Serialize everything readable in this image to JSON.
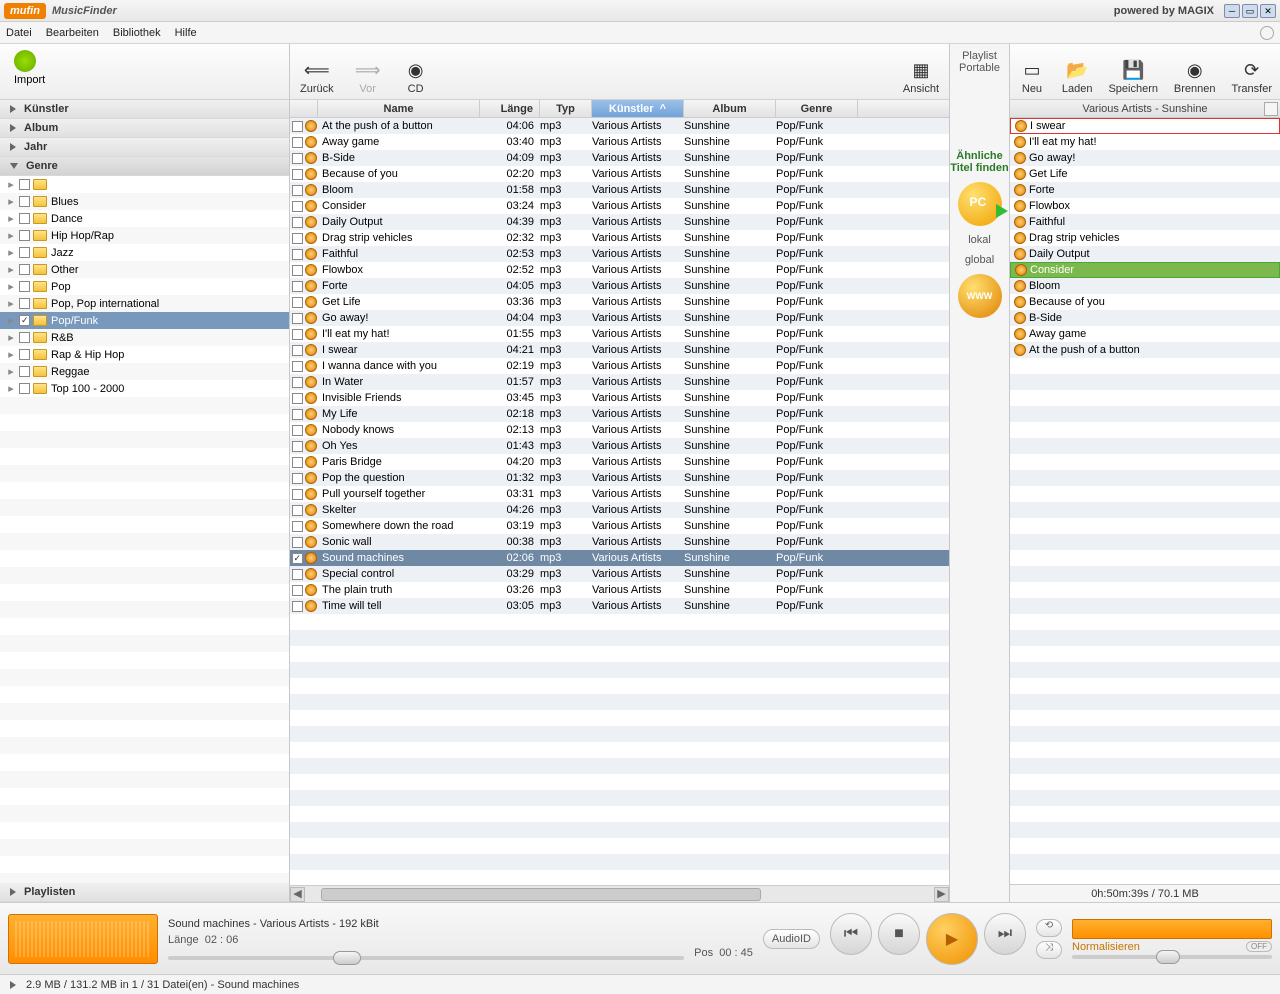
{
  "title": {
    "logo": "mufin",
    "app": "MusicFinder",
    "powered": "powered by MAGIX"
  },
  "menu": [
    "Datei",
    "Bearbeiten",
    "Bibliothek",
    "Hilfe"
  ],
  "left": {
    "import": "Import",
    "sections": [
      "Künstler",
      "Album",
      "Jahr",
      "Genre",
      "Playlisten"
    ],
    "genres": [
      {
        "label": ""
      },
      {
        "label": "Blues"
      },
      {
        "label": "Dance"
      },
      {
        "label": "Hip Hop/Rap"
      },
      {
        "label": "Jazz"
      },
      {
        "label": "Other"
      },
      {
        "label": "Pop"
      },
      {
        "label": "Pop, Pop international"
      },
      {
        "label": "Pop/Funk",
        "sel": true,
        "chk": true
      },
      {
        "label": "R&B"
      },
      {
        "label": "Rap & Hip Hop"
      },
      {
        "label": "Reggae"
      },
      {
        "label": "Top 100 - 2000"
      }
    ]
  },
  "centerToolbar": {
    "back": "Zurück",
    "fwd": "Vor",
    "cd": "CD",
    "view": "Ansicht"
  },
  "cols": [
    "Name",
    "Länge",
    "Typ",
    "Künstler",
    "Album",
    "Genre"
  ],
  "sortIndicator": "^",
  "tracks": [
    {
      "n": "At the push of a button",
      "l": "04:06",
      "t": "mp3",
      "a": "Various Artists",
      "al": "Sunshine",
      "g": "Pop/Funk"
    },
    {
      "n": "Away game",
      "l": "03:40",
      "t": "mp3",
      "a": "Various Artists",
      "al": "Sunshine",
      "g": "Pop/Funk"
    },
    {
      "n": "B-Side",
      "l": "04:09",
      "t": "mp3",
      "a": "Various Artists",
      "al": "Sunshine",
      "g": "Pop/Funk"
    },
    {
      "n": "Because of you",
      "l": "02:20",
      "t": "mp3",
      "a": "Various Artists",
      "al": "Sunshine",
      "g": "Pop/Funk"
    },
    {
      "n": "Bloom",
      "l": "01:58",
      "t": "mp3",
      "a": "Various Artists",
      "al": "Sunshine",
      "g": "Pop/Funk"
    },
    {
      "n": "Consider",
      "l": "03:24",
      "t": "mp3",
      "a": "Various Artists",
      "al": "Sunshine",
      "g": "Pop/Funk"
    },
    {
      "n": "Daily Output",
      "l": "04:39",
      "t": "mp3",
      "a": "Various Artists",
      "al": "Sunshine",
      "g": "Pop/Funk"
    },
    {
      "n": "Drag strip vehicles",
      "l": "02:32",
      "t": "mp3",
      "a": "Various Artists",
      "al": "Sunshine",
      "g": "Pop/Funk"
    },
    {
      "n": "Faithful",
      "l": "02:53",
      "t": "mp3",
      "a": "Various Artists",
      "al": "Sunshine",
      "g": "Pop/Funk"
    },
    {
      "n": "Flowbox",
      "l": "02:52",
      "t": "mp3",
      "a": "Various Artists",
      "al": "Sunshine",
      "g": "Pop/Funk"
    },
    {
      "n": "Forte",
      "l": "04:05",
      "t": "mp3",
      "a": "Various Artists",
      "al": "Sunshine",
      "g": "Pop/Funk"
    },
    {
      "n": "Get Life",
      "l": "03:36",
      "t": "mp3",
      "a": "Various Artists",
      "al": "Sunshine",
      "g": "Pop/Funk"
    },
    {
      "n": "Go away!",
      "l": "04:04",
      "t": "mp3",
      "a": "Various Artists",
      "al": "Sunshine",
      "g": "Pop/Funk"
    },
    {
      "n": "I'll eat my hat!",
      "l": "01:55",
      "t": "mp3",
      "a": "Various Artists",
      "al": "Sunshine",
      "g": "Pop/Funk"
    },
    {
      "n": "I swear",
      "l": "04:21",
      "t": "mp3",
      "a": "Various Artists",
      "al": "Sunshine",
      "g": "Pop/Funk"
    },
    {
      "n": "I wanna dance with you",
      "l": "02:19",
      "t": "mp3",
      "a": "Various Artists",
      "al": "Sunshine",
      "g": "Pop/Funk"
    },
    {
      "n": "In Water",
      "l": "01:57",
      "t": "mp3",
      "a": "Various Artists",
      "al": "Sunshine",
      "g": "Pop/Funk"
    },
    {
      "n": "Invisible Friends",
      "l": "03:45",
      "t": "mp3",
      "a": "Various Artists",
      "al": "Sunshine",
      "g": "Pop/Funk"
    },
    {
      "n": "My Life",
      "l": "02:18",
      "t": "mp3",
      "a": "Various Artists",
      "al": "Sunshine",
      "g": "Pop/Funk"
    },
    {
      "n": "Nobody knows",
      "l": "02:13",
      "t": "mp3",
      "a": "Various Artists",
      "al": "Sunshine",
      "g": "Pop/Funk"
    },
    {
      "n": "Oh Yes",
      "l": "01:43",
      "t": "mp3",
      "a": "Various Artists",
      "al": "Sunshine",
      "g": "Pop/Funk"
    },
    {
      "n": "Paris Bridge",
      "l": "04:20",
      "t": "mp3",
      "a": "Various Artists",
      "al": "Sunshine",
      "g": "Pop/Funk"
    },
    {
      "n": "Pop the question",
      "l": "01:32",
      "t": "mp3",
      "a": "Various Artists",
      "al": "Sunshine",
      "g": "Pop/Funk"
    },
    {
      "n": "Pull yourself together",
      "l": "03:31",
      "t": "mp3",
      "a": "Various Artists",
      "al": "Sunshine",
      "g": "Pop/Funk"
    },
    {
      "n": "Skelter",
      "l": "04:26",
      "t": "mp3",
      "a": "Various Artists",
      "al": "Sunshine",
      "g": "Pop/Funk"
    },
    {
      "n": "Somewhere down the road",
      "l": "03:19",
      "t": "mp3",
      "a": "Various Artists",
      "al": "Sunshine",
      "g": "Pop/Funk"
    },
    {
      "n": "Sonic wall",
      "l": "00:38",
      "t": "mp3",
      "a": "Various Artists",
      "al": "Sunshine",
      "g": "Pop/Funk"
    },
    {
      "n": "Sound machines",
      "l": "02:06",
      "t": "mp3",
      "a": "Various Artists",
      "al": "Sunshine",
      "g": "Pop/Funk",
      "sel": true,
      "chk": true
    },
    {
      "n": "Special control",
      "l": "03:29",
      "t": "mp3",
      "a": "Various Artists",
      "al": "Sunshine",
      "g": "Pop/Funk"
    },
    {
      "n": "The plain truth",
      "l": "03:26",
      "t": "mp3",
      "a": "Various Artists",
      "al": "Sunshine",
      "g": "Pop/Funk"
    },
    {
      "n": "Time will tell",
      "l": "03:05",
      "t": "mp3",
      "a": "Various Artists",
      "al": "Sunshine",
      "g": "Pop/Funk"
    }
  ],
  "between": {
    "playlist": "Playlist",
    "portable": "Portable",
    "similar1": "Ähnliche",
    "similar2": "Titel finden",
    "lokal": "lokal",
    "global": "global"
  },
  "rightToolbar": [
    {
      "label": "Neu",
      "name": "new"
    },
    {
      "label": "Laden",
      "name": "load"
    },
    {
      "label": "Speichern",
      "name": "save"
    },
    {
      "label": "Brennen",
      "name": "burn"
    },
    {
      "label": "Transfer",
      "name": "transfer"
    }
  ],
  "playlistHeader": "Various Artists  -  Sunshine",
  "playlist": [
    {
      "n": "I swear",
      "cls": "red"
    },
    {
      "n": "I'll eat my hat!"
    },
    {
      "n": "Go away!"
    },
    {
      "n": "Get Life"
    },
    {
      "n": "Forte"
    },
    {
      "n": "Flowbox"
    },
    {
      "n": "Faithful"
    },
    {
      "n": "Drag strip vehicles"
    },
    {
      "n": "Daily Output"
    },
    {
      "n": "Consider",
      "cls": "green"
    },
    {
      "n": "Bloom"
    },
    {
      "n": "Because of you"
    },
    {
      "n": "B-Side"
    },
    {
      "n": "Away game"
    },
    {
      "n": "At the push of a button"
    }
  ],
  "playlistFooter": "0h:50m:39s / 70.1 MB",
  "player": {
    "now": "Sound machines - Various Artists - 192 kBit",
    "lenLabel": "Länge",
    "len": "02 : 06",
    "posLabel": "Pos",
    "pos": "00 : 45",
    "audioid": "AudioID",
    "norm": "Normalisieren",
    "off": "OFF"
  },
  "status": "2.9 MB / 131.2 MB in 1 / 31 Datei(en)   -   Sound machines"
}
